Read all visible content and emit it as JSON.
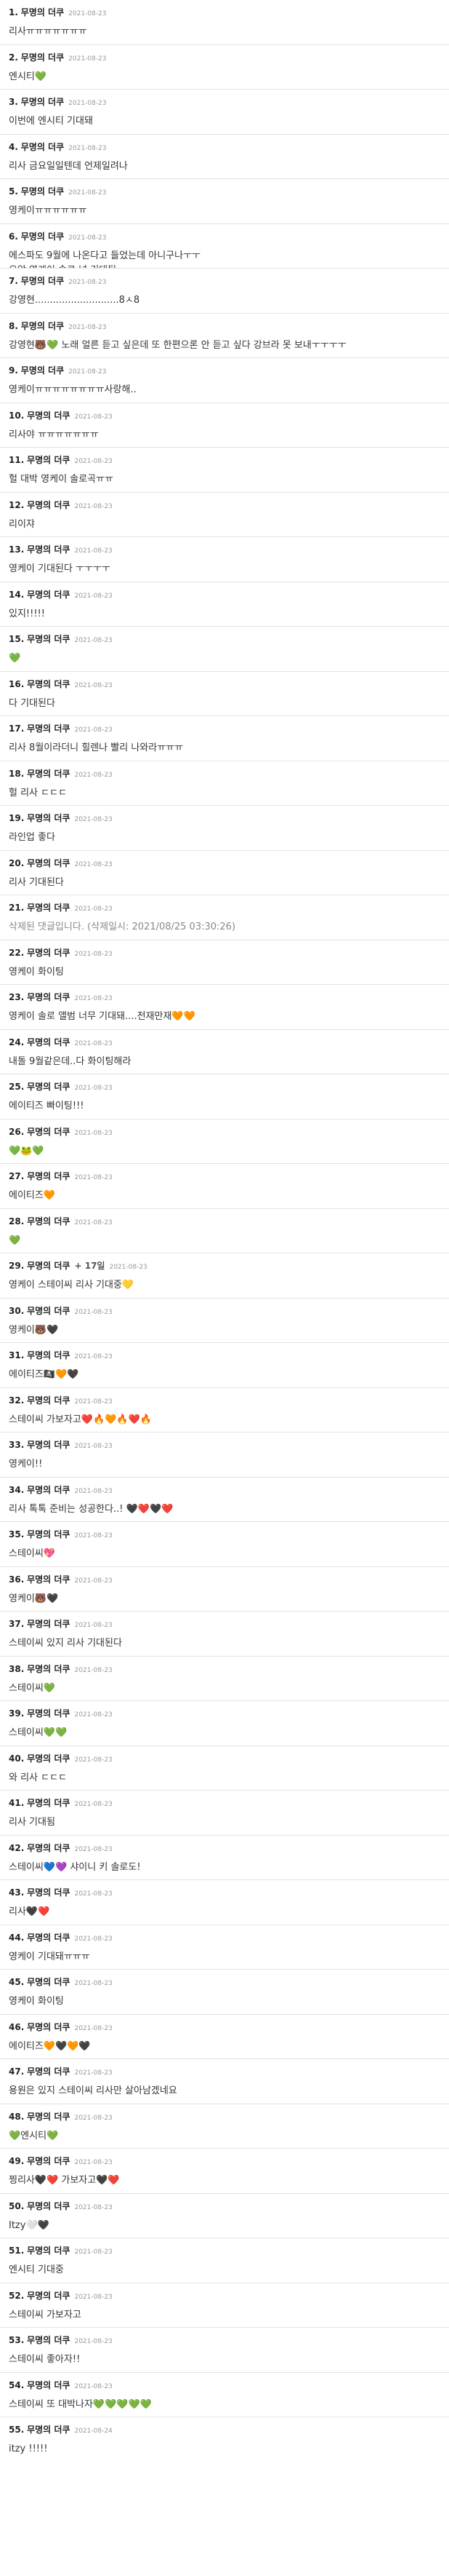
{
  "comments": [
    {
      "no": "1.",
      "author": "무명의 더쿠",
      "date": "2021-08-23",
      "text": "리사ㅠㅠㅠㅠㅠㅠㅠ"
    },
    {
      "no": "2.",
      "author": "무명의 더쿠",
      "date": "2021-08-23",
      "text": "엔시티💚"
    },
    {
      "no": "3.",
      "author": "무명의 더쿠",
      "date": "2021-08-23",
      "text": "이번에 엔시티 기대돼"
    },
    {
      "no": "4.",
      "author": "무명의 더쿠",
      "date": "2021-08-23",
      "text": "리사 금요일일텐데 언제일려나"
    },
    {
      "no": "5.",
      "author": "무명의 더쿠",
      "date": "2021-08-23",
      "text": "영케이ㅠㅠㅠㅠㅠㅠ"
    },
    {
      "no": "6.",
      "author": "무명의 더쿠",
      "date": "2021-08-23",
      "text": "에스파도 9월에 나온다고 들었는데 아니구나ㅜㅜ\n으악 영케이 솔로 넘 기대됨"
    },
    {
      "no": "7.",
      "author": "무명의 더쿠",
      "date": "2021-08-23",
      "text": "강영현............................8ㅅ8"
    },
    {
      "no": "8.",
      "author": "무명의 더쿠",
      "date": "2021-08-23",
      "text": "강영현🐻💚 노래 얼른 듣고 싶은데 또 한편으론 안 듣고 싶다 강브라 못 보내ㅜㅜㅜㅜ"
    },
    {
      "no": "9.",
      "author": "무명의 더쿠",
      "date": "2021-08-23",
      "text": "영케이ㅠㅠㅠㅠㅠㅠㅠㅠ사랑해.."
    },
    {
      "no": "10.",
      "author": "무명의 더쿠",
      "date": "2021-08-23",
      "text": "리사야 ㅠㅠㅠㅠㅠㅠㅠ"
    },
    {
      "no": "11.",
      "author": "무명의 더쿠",
      "date": "2021-08-23",
      "text": "헐 대박 영케이 솔로곡ㅠㅠ"
    },
    {
      "no": "12.",
      "author": "무명의 더쿠",
      "date": "2021-08-23",
      "text": "리이쟈"
    },
    {
      "no": "13.",
      "author": "무명의 더쿠",
      "date": "2021-08-23",
      "text": "영케이 기대된다 ㅜㅜㅜㅜ"
    },
    {
      "no": "14.",
      "author": "무명의 더쿠",
      "date": "2021-08-23",
      "text": "있지!!!!!"
    },
    {
      "no": "15.",
      "author": "무명의 더쿠",
      "date": "2021-08-23",
      "text": "💚"
    },
    {
      "no": "16.",
      "author": "무명의 더쿠",
      "date": "2021-08-23",
      "text": "다 기대된다"
    },
    {
      "no": "17.",
      "author": "무명의 더쿠",
      "date": "2021-08-23",
      "text": "리사 8월이라더니 힐렌나 빨리 나와라ㅠㅠㅠ"
    },
    {
      "no": "18.",
      "author": "무명의 더쿠",
      "date": "2021-08-23",
      "text": "헐 리사 ㄷㄷㄷ"
    },
    {
      "no": "19.",
      "author": "무명의 더쿠",
      "date": "2021-08-23",
      "text": "라인업 좋다"
    },
    {
      "no": "20.",
      "author": "무명의 더쿠",
      "date": "2021-08-23",
      "text": "리사 기대된다"
    },
    {
      "no": "21.",
      "author": "무명의 더쿠",
      "date": "2021-08-23",
      "text": "삭제된 댓글입니다. (삭제일시: 2021/08/25 03:30:26)",
      "deleted": true
    },
    {
      "no": "22.",
      "author": "무명의 더쿠",
      "date": "2021-08-23",
      "text": "영케이 화이팅"
    },
    {
      "no": "23.",
      "author": "무명의 더쿠",
      "date": "2021-08-23",
      "text": "영케이 솔로 앨범 너무 기대돼....전재만재🧡🧡"
    },
    {
      "no": "24.",
      "author": "무명의 더쿠",
      "date": "2021-08-23",
      "text": "내돌 9월같은데..다 화이팅해라"
    },
    {
      "no": "25.",
      "author": "무명의 더쿠",
      "date": "2021-08-23",
      "text": "에이티즈 빠이팅!!!"
    },
    {
      "no": "26.",
      "author": "무명의 더쿠",
      "date": "2021-08-23",
      "text": "💚🐸💚"
    },
    {
      "no": "27.",
      "author": "무명의 더쿠",
      "date": "2021-08-23",
      "text": "에이티즈🧡"
    },
    {
      "no": "28.",
      "author": "무명의 더쿠",
      "date": "2021-08-23",
      "text": "💚"
    },
    {
      "no": "29.",
      "author": "무명의 더쿠",
      "extra": "+ 17일",
      "date": "2021-08-23",
      "text": "영케이 스테이씨 리사 기대중💛"
    },
    {
      "no": "30.",
      "author": "무명의 더쿠",
      "date": "2021-08-23",
      "text": "영케이🐻🖤"
    },
    {
      "no": "31.",
      "author": "무명의 더쿠",
      "date": "2021-08-23",
      "text": "에이티즈🏴‍☠️🧡🖤"
    },
    {
      "no": "32.",
      "author": "무명의 더쿠",
      "date": "2021-08-23",
      "text": "스테이씨 가보자고❤️🔥🧡🔥❤️🔥"
    },
    {
      "no": "33.",
      "author": "무명의 더쿠",
      "date": "2021-08-23",
      "text": "영케이!!"
    },
    {
      "no": "34.",
      "author": "무명의 더쿠",
      "date": "2021-08-23",
      "text": "리사 톡톡 준비는 성공한다..! 🖤❤️🖤❤️"
    },
    {
      "no": "35.",
      "author": "무명의 더쿠",
      "date": "2021-08-23",
      "text": "스테이씨💖"
    },
    {
      "no": "36.",
      "author": "무명의 더쿠",
      "date": "2021-08-23",
      "text": "영케이🐻🖤"
    },
    {
      "no": "37.",
      "author": "무명의 더쿠",
      "date": "2021-08-23",
      "text": "스테이씨 있지 리사 기대된다"
    },
    {
      "no": "38.",
      "author": "무명의 더쿠",
      "date": "2021-08-23",
      "text": "스테이씨💚"
    },
    {
      "no": "39.",
      "author": "무명의 더쿠",
      "date": "2021-08-23",
      "text": "스테이씨💚💚"
    },
    {
      "no": "40.",
      "author": "무명의 더쿠",
      "date": "2021-08-23",
      "text": "와 리사 ㄷㄷㄷ"
    },
    {
      "no": "41.",
      "author": "무명의 더쿠",
      "date": "2021-08-23",
      "text": "리사 기대됨"
    },
    {
      "no": "42.",
      "author": "무명의 더쿠",
      "date": "2021-08-23",
      "text": "스테이씨💙💜 샤이니 키 솔로도!"
    },
    {
      "no": "43.",
      "author": "무명의 더쿠",
      "date": "2021-08-23",
      "text": "리사🖤❤️"
    },
    {
      "no": "44.",
      "author": "무명의 더쿠",
      "date": "2021-08-23",
      "text": "영케이 기대돼ㅠㅠㅠ"
    },
    {
      "no": "45.",
      "author": "무명의 더쿠",
      "date": "2021-08-23",
      "text": "영케이 화이팅"
    },
    {
      "no": "46.",
      "author": "무명의 더쿠",
      "date": "2021-08-23",
      "text": "에이티즈🧡🖤🧡🖤"
    },
    {
      "no": "47.",
      "author": "무명의 더쿠",
      "date": "2021-08-23",
      "text": "용원은 있지 스테이씨 리사만 살아남겠네요"
    },
    {
      "no": "48.",
      "author": "무명의 더쿠",
      "date": "2021-08-23",
      "text": "💚엔시티💚"
    },
    {
      "no": "49.",
      "author": "무명의 더쿠",
      "date": "2021-08-23",
      "text": "찡리사🖤❤️ 가보자고🖤❤️"
    },
    {
      "no": "50.",
      "author": "무명의 더쿠",
      "date": "2021-08-23",
      "text": "Itzy🤍🖤"
    },
    {
      "no": "51.",
      "author": "무명의 더쿠",
      "date": "2021-08-23",
      "text": "엔시티 기대중"
    },
    {
      "no": "52.",
      "author": "무명의 더쿠",
      "date": "2021-08-23",
      "text": "스테이씨 가보자고"
    },
    {
      "no": "53.",
      "author": "무명의 더쿠",
      "date": "2021-08-23",
      "text": "스테이씨 좋아자!!"
    },
    {
      "no": "54.",
      "author": "무명의 더쿠",
      "date": "2021-08-23",
      "text": "스테이씨 또 대박나자💚💚💚💚💚"
    },
    {
      "no": "55.",
      "author": "무명의 더쿠",
      "date": "2021-08-24",
      "text": "itzy !!!!!"
    }
  ]
}
